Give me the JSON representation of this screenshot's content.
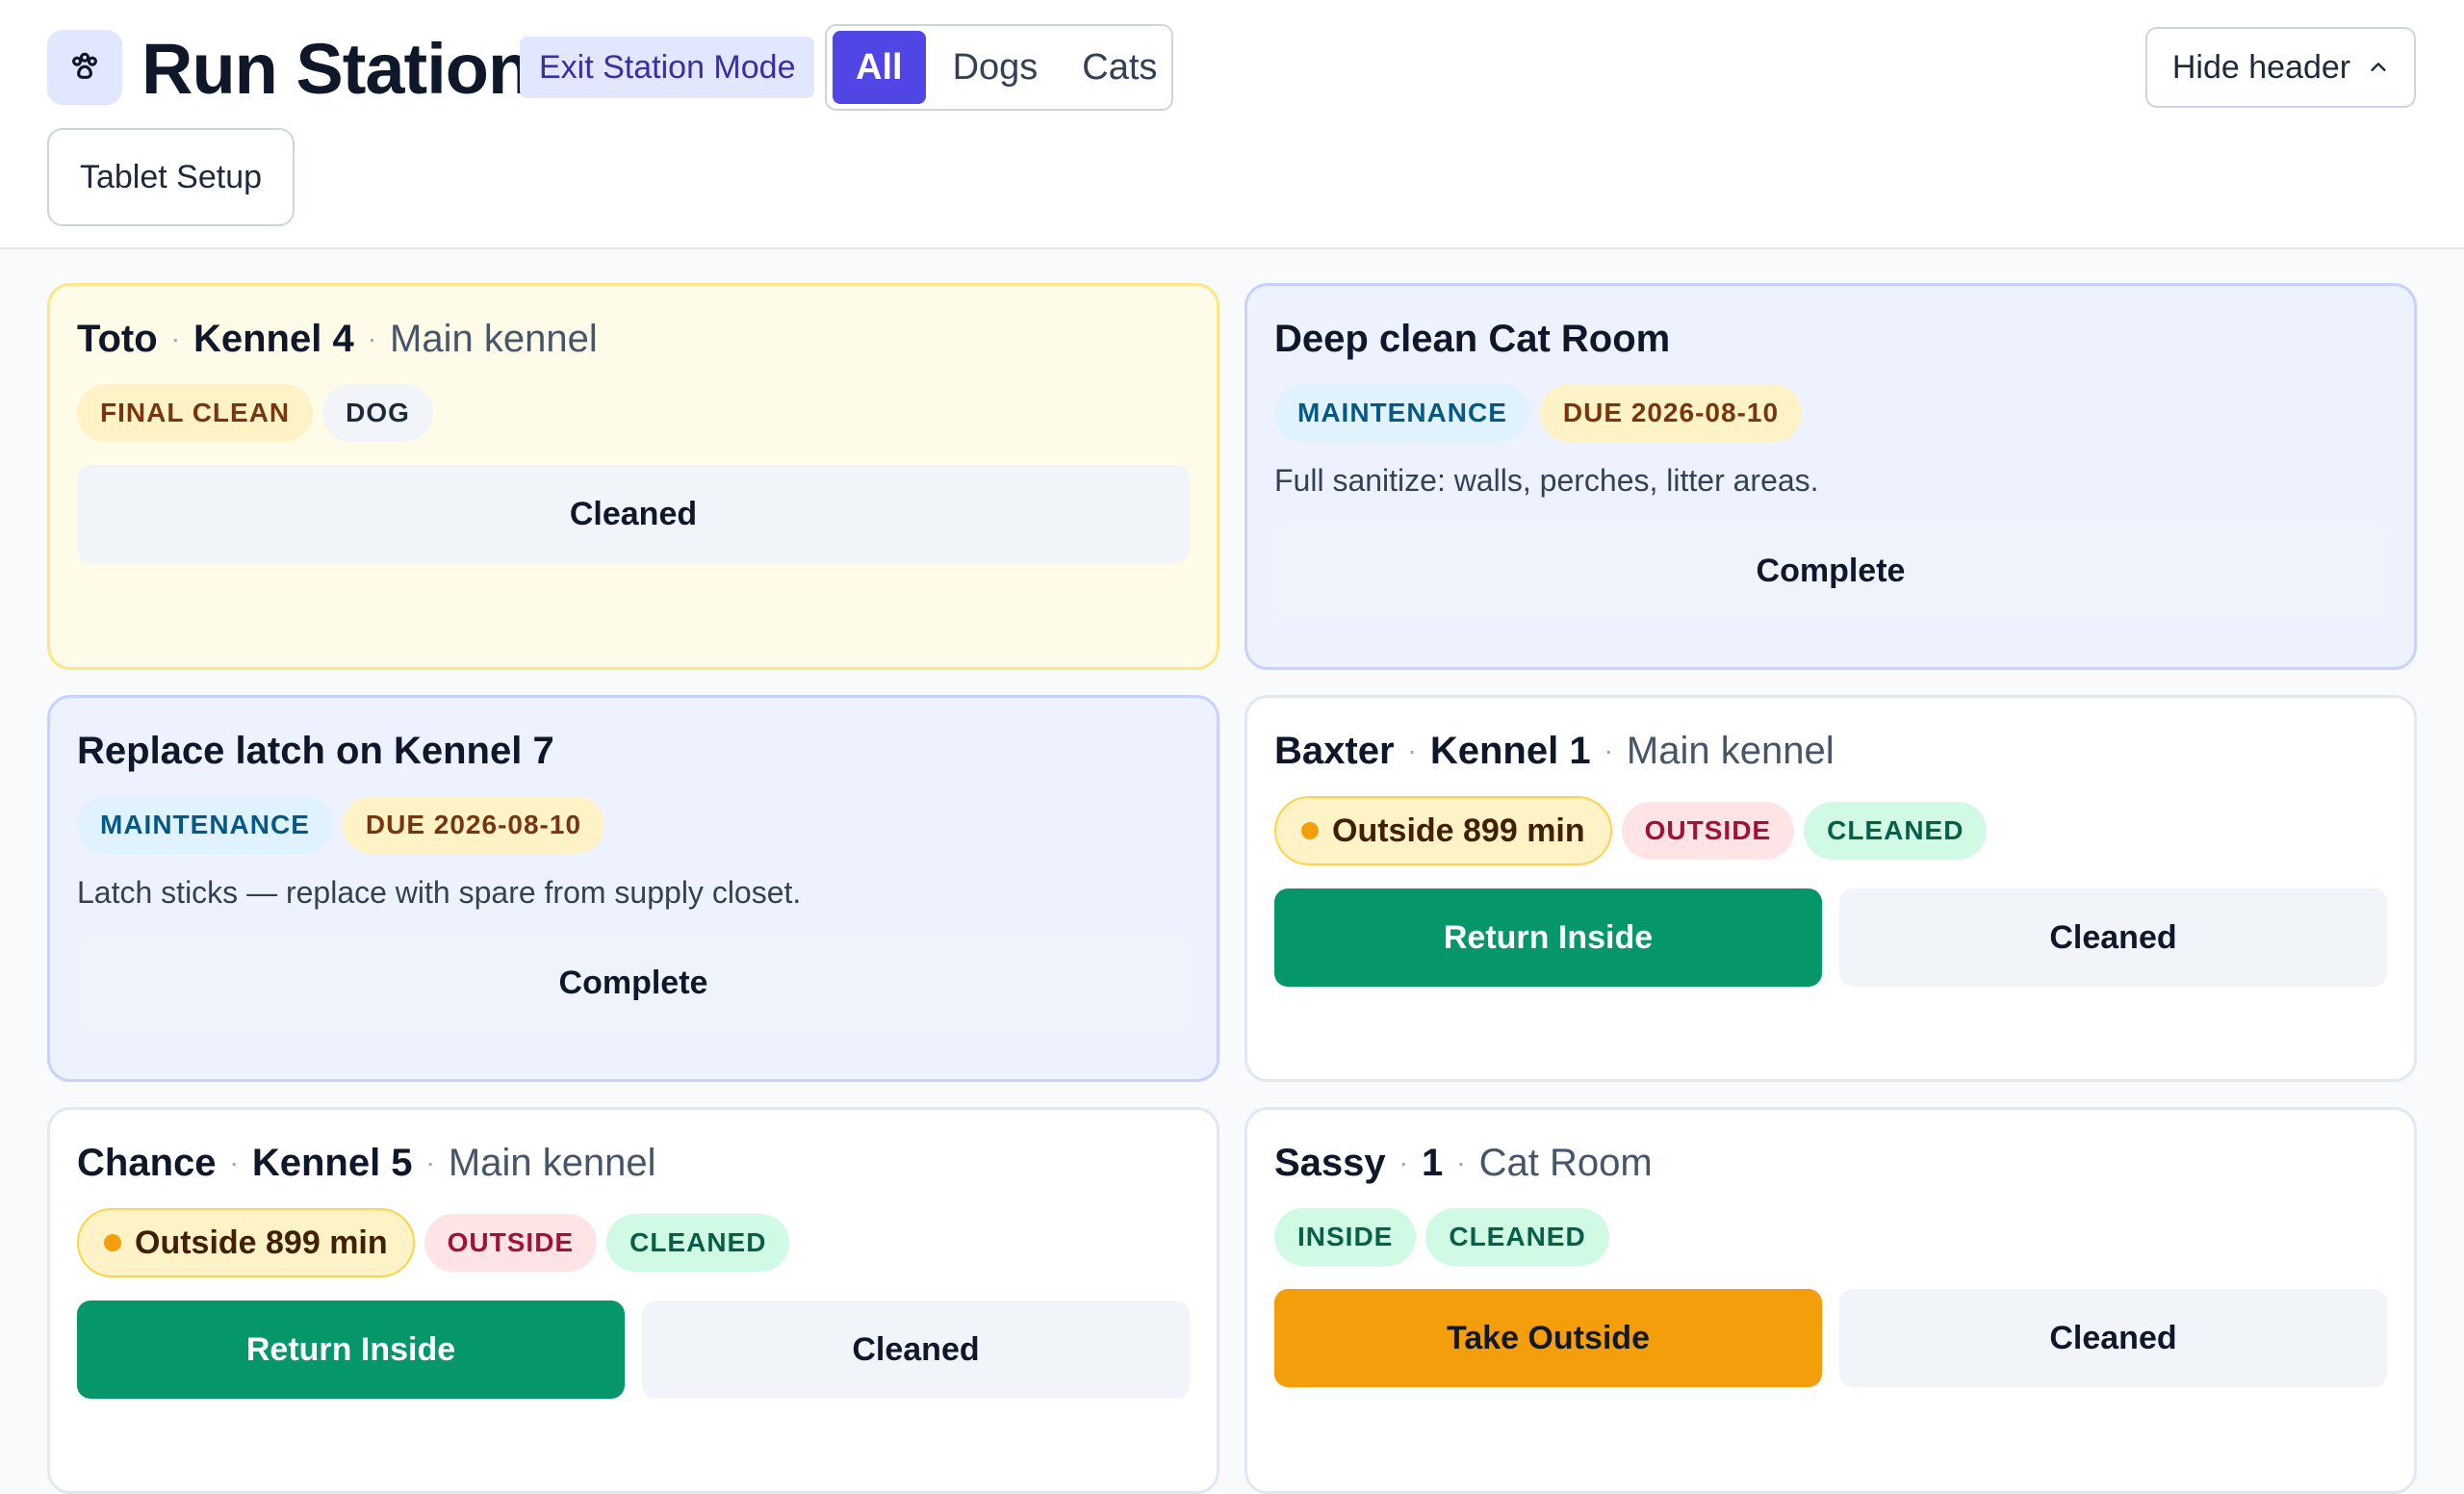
{
  "header": {
    "title": "Run Station",
    "exit_label": "Exit Station Mode",
    "filters": [
      {
        "label": "All",
        "active": true
      },
      {
        "label": "Dogs",
        "active": false
      },
      {
        "label": "Cats",
        "active": false
      }
    ],
    "tablet_setup_label": "Tablet Setup",
    "hide_header_label": "Hide header",
    "accent_color": "#4f46e5"
  },
  "cards": [
    {
      "name": "Toto",
      "unit": "Kennel 4",
      "location": "Main kennel",
      "badges": [
        "FINAL CLEAN",
        "DOG"
      ],
      "actions": [
        "Cleaned"
      ]
    },
    {
      "title": "Deep clean Cat Room",
      "badges": [
        "MAINTENANCE",
        "DUE 2026-08-10"
      ],
      "description": "Full sanitize: walls, perches, litter areas.",
      "actions": [
        "Complete"
      ]
    },
    {
      "title": "Replace latch on Kennel 7",
      "badges": [
        "MAINTENANCE",
        "DUE 2026-08-10"
      ],
      "description": "Latch sticks — replace with spare from supply closet.",
      "actions": [
        "Complete"
      ]
    },
    {
      "name": "Baxter",
      "unit": "Kennel 1",
      "location": "Main kennel",
      "timer": "Outside 899 min",
      "badges": [
        "OUTSIDE",
        "CLEANED"
      ],
      "actions": [
        "Return Inside",
        "Cleaned"
      ]
    },
    {
      "name": "Chance",
      "unit": "Kennel 5",
      "location": "Main kennel",
      "timer": "Outside 899 min",
      "badges": [
        "OUTSIDE",
        "CLEANED"
      ],
      "actions": [
        "Return Inside",
        "Cleaned"
      ]
    },
    {
      "name": "Sassy",
      "unit": "1",
      "location": "Cat Room",
      "badges": [
        "INSIDE",
        "CLEANED"
      ],
      "actions": [
        "Take Outside",
        "Cleaned"
      ]
    }
  ]
}
